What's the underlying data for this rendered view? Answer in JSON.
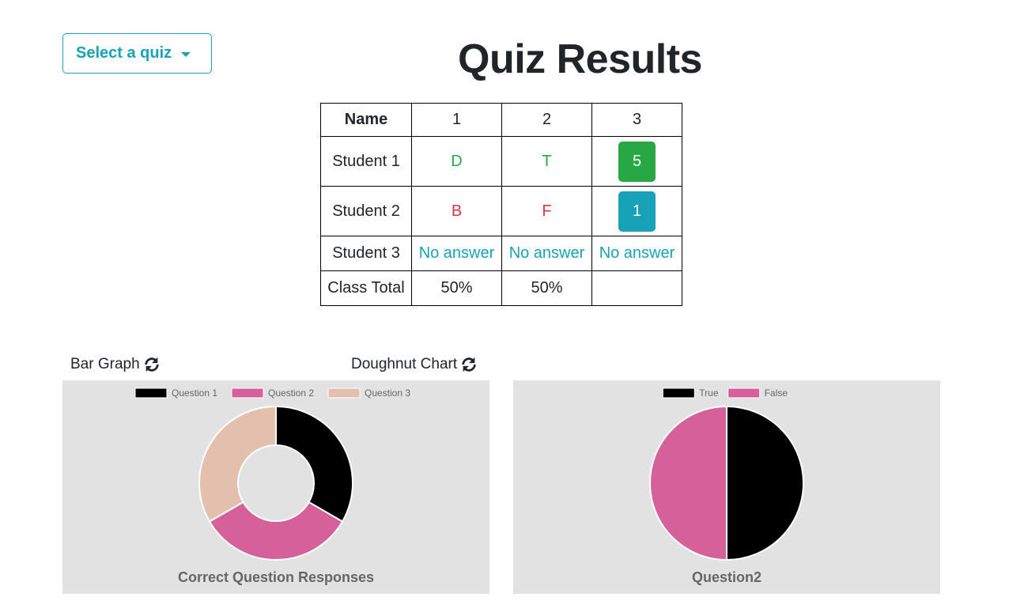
{
  "quiz_select": {
    "label": "Select a quiz"
  },
  "title": "Quiz Results",
  "table": {
    "headers": [
      "Name",
      "1",
      "2",
      "3"
    ],
    "rows": [
      {
        "name": "Student 1",
        "cells": [
          "D",
          "T",
          "5"
        ]
      },
      {
        "name": "Student 2",
        "cells": [
          "B",
          "F",
          "1"
        ]
      },
      {
        "name": "Student 3",
        "cells": [
          "No answer",
          "No answer",
          "No answer"
        ]
      }
    ],
    "total": {
      "name": "Class Total",
      "cells": [
        "50%",
        "50%",
        ""
      ]
    }
  },
  "toggles": {
    "bar": "Bar Graph",
    "doughnut": "Doughnut Chart"
  },
  "colors": {
    "accent": "#17a2b8",
    "correct": "#28a745",
    "wrong": "#dc3545",
    "panel": "#e2e2e2"
  },
  "chart_data": [
    {
      "type": "pie",
      "variant": "doughnut",
      "title": "Correct Question Responses",
      "legend_position": "top",
      "categories": [
        "Question 1",
        "Question 2",
        "Question 3"
      ],
      "values": [
        1,
        1,
        1
      ],
      "colors": [
        "#000000",
        "#d5609a",
        "#e3c0ad"
      ]
    },
    {
      "type": "pie",
      "title": "Question2",
      "legend_position": "top",
      "categories": [
        "True",
        "False"
      ],
      "values": [
        1,
        1
      ],
      "colors": [
        "#000000",
        "#d5609a"
      ]
    }
  ]
}
